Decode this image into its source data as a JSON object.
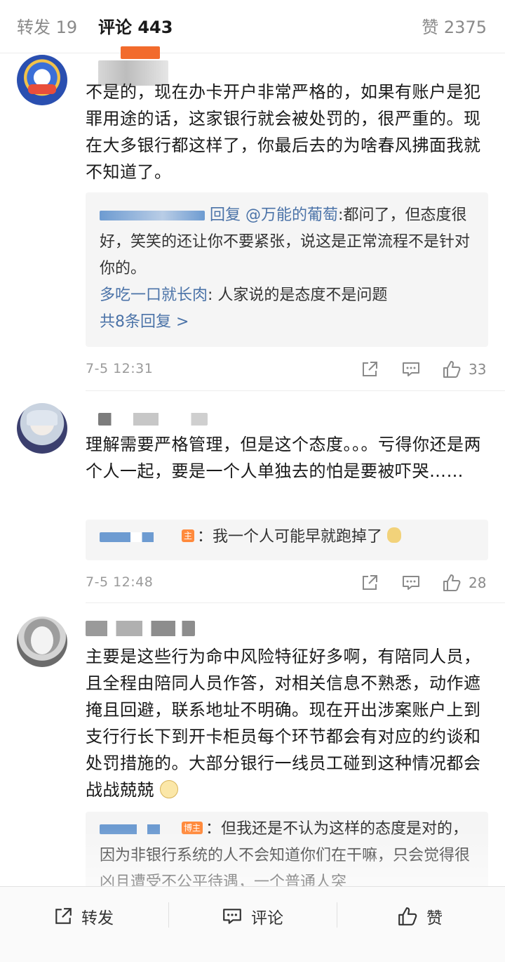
{
  "tabs": {
    "repost": "转发 19",
    "comment": "评论 443",
    "like": "赞 2375"
  },
  "comments": [
    {
      "text": "不是的，现在办卡开户非常严格的，如果有账户是犯罪用途的话，这家银行就会被处罚的，很严重的。现在大多银行都这样了，你最后去的为啥春风拂面我就不知道了。",
      "replies": {
        "r1_prefix": "回复",
        "r1_mention": "@万能的葡萄",
        "r1_text": ":都问了，但态度很好，笑笑的还让你不要紧张，说这是正常流程不是针对你的。",
        "r2_user": "多吃一口就长肉",
        "r2_text": ": 人家说的是态度不是问题",
        "more": "共8条回复 >"
      },
      "time": "7-5 12:31",
      "likes": "33"
    },
    {
      "text": "理解需要严格管理，但是这个态度。。。亏得你还是两个人一起，要是一个人单独去的怕是要被吓哭……",
      "replies": {
        "host_tag": "主",
        "r1_text": "：我一个人可能早就跑掉了"
      },
      "time": "7-5 12:48",
      "likes": "28"
    },
    {
      "text": "主要是这些行为命中风险特征好多啊，有陪同人员，且全程由陪同人员作答，对相关信息不熟悉，动作遮掩且回避，联系地址不明确。现在开出涉案账户上到支行行长下到开卡柜员每个环节都会有对应的约谈和处罚措施的。大部分银行一线员工碰到这种情况都会战战兢兢",
      "replies": {
        "host_tag": "博主",
        "r1_text": "：但我还是不认为这样的态度是对的，因为非银行系统的人不会知道你们在干嘛，只会觉得很凶且遭受不公平待遇，一个普通人突"
      }
    }
  ],
  "bottom_bar": {
    "repost": "转发",
    "comment": "评论",
    "like": "赞"
  },
  "colors": {
    "link": "#4b73a8",
    "host_tag": "#ff8a3d",
    "muted": "#8a8a8a"
  }
}
